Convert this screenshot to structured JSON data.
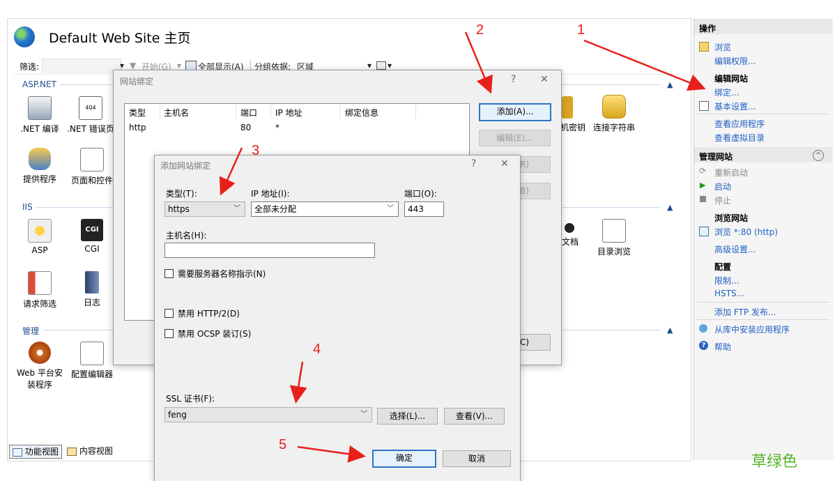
{
  "main": {
    "title": "Default Web Site 主页",
    "filter": {
      "label": "筛选:",
      "start_label": "开始(G)",
      "show_all_label": "全部显示(A)",
      "group_label": "分组依据:",
      "group_value": "区域"
    },
    "sections": {
      "aspnet": "ASP.NET",
      "iis": "IIS",
      "manage": "管理"
    },
    "features": {
      "net_compile": ".NET 编译",
      "net_error": ".NET 错误页",
      "machine_key": "机密钥",
      "conn_strings": "连接字符串",
      "providers": "提供程序",
      "pages_controls": "页面和控件",
      "asp": "ASP",
      "cgi": "CGI",
      "doc": "文档",
      "dir_browse": "目录浏览",
      "req_filter": "请求筛选",
      "logging": "日志",
      "webpi_l1": "Web 平台安",
      "webpi_l2": "装程序",
      "config_editor": "配置编辑器"
    },
    "bottom": {
      "features_view": "功能视图",
      "content_view": "内容视图"
    }
  },
  "actions": {
    "header": "操作",
    "browse": "浏览",
    "edit_perms": "编辑权限...",
    "edit_site_h": "编辑网站",
    "bindings": "绑定...",
    "basic_settings": "基本设置...",
    "view_apps": "查看应用程序",
    "view_vdirs": "查看虚拟目录",
    "manage_site_h": "管理网站",
    "restart": "重新启动",
    "start": "启动",
    "stop": "停止",
    "browse_site_h": "浏览网站",
    "browse_80": "浏览 *:80 (http)",
    "advanced": "高级设置...",
    "config_h": "配置",
    "limits": "限制...",
    "hsts": "HSTS...",
    "add_ftp": "添加 FTP 发布...",
    "install_from_gallery": "从库中安装应用程序",
    "help": "帮助"
  },
  "binding_dialog": {
    "title": "网站绑定",
    "help_btn": "?",
    "close_btn": "✕",
    "columns": [
      "类型",
      "主机名",
      "端口",
      "IP 地址",
      "绑定信息"
    ],
    "rows": [
      [
        "http",
        "",
        "80",
        "*",
        ""
      ]
    ],
    "add": "添加(A)...",
    "edit": "编辑(E)...",
    "remove_tail": "R)",
    "browse_tail": "B)",
    "close_tail": "C)"
  },
  "add_dialog": {
    "title": "添加网站绑定",
    "help_btn": "?",
    "close_btn": "✕",
    "type_label": "类型(T):",
    "type_value": "https",
    "ip_label": "IP 地址(I):",
    "ip_value": "全部未分配",
    "port_label": "端口(O):",
    "port_value": "443",
    "host_label": "主机名(H):",
    "host_value": "",
    "sni_label": "需要服务器名称指示(N)",
    "http2_label": "禁用 HTTP/2(D)",
    "ocsp_label": "禁用 OCSP 装订(S)",
    "ssl_label": "SSL 证书(F):",
    "ssl_value": "feng",
    "select_btn": "选择(L)...",
    "view_btn": "查看(V)...",
    "ok": "确定",
    "cancel": "取消"
  },
  "annotations": {
    "n1": "1",
    "n2": "2",
    "n3": "3",
    "n4": "4",
    "n5": "5",
    "color": "#e8201a"
  },
  "watermark": "草绿色",
  "colors": {
    "link": "#2160c4",
    "section": "#1f4e8c",
    "dialog_bg": "#f0f0f0",
    "default_button_border": "#2f74c8"
  }
}
